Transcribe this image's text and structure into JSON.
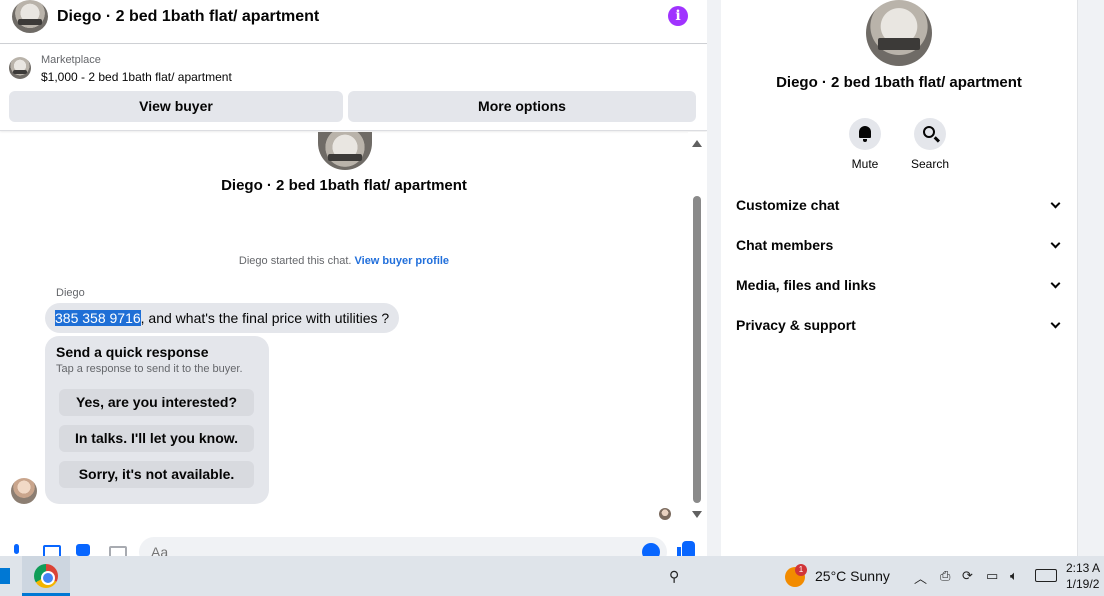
{
  "header": {
    "title": "Diego · 2 bed 1bath flat/ apartment",
    "info_icon": "info-icon",
    "accent": "#a033ff"
  },
  "marketplace": {
    "label": "Marketplace",
    "listing": "$1,000 - 2 bed 1bath flat/ apartment",
    "view_buyer": "View buyer",
    "more_options": "More options"
  },
  "thread": {
    "title": "Diego · 2 bed 1bath flat/ apartment",
    "started_text": "Diego started this chat.",
    "buyer_profile_link": "View buyer profile",
    "sender": "Diego",
    "message_highlight": "385 358 9716",
    "message_rest": ", and what's the final price with utilities ?",
    "quick_response": {
      "title": "Send a quick response",
      "subtitle": "Tap a response to send it to the buyer.",
      "options": [
        "Yes, are you interested?",
        "In talks. I'll let you know.",
        "Sorry, it's not available."
      ]
    }
  },
  "composer": {
    "placeholder": "Aa"
  },
  "details": {
    "title": "Diego · 2 bed 1bath flat/ apartment",
    "actions": [
      {
        "label": "Mute",
        "icon": "bell-icon"
      },
      {
        "label": "Search",
        "icon": "search-icon"
      }
    ],
    "menu": [
      "Customize chat",
      "Chat members",
      "Media, files and links",
      "Privacy & support"
    ]
  },
  "taskbar": {
    "weather_badge": "1",
    "weather": "25°C  Sunny",
    "time": "2:13 A",
    "date": "1/19/2"
  },
  "colors": {
    "link": "#216fdb",
    "brand_blue": "#0866ff",
    "highlight": "#1f6fd6"
  }
}
